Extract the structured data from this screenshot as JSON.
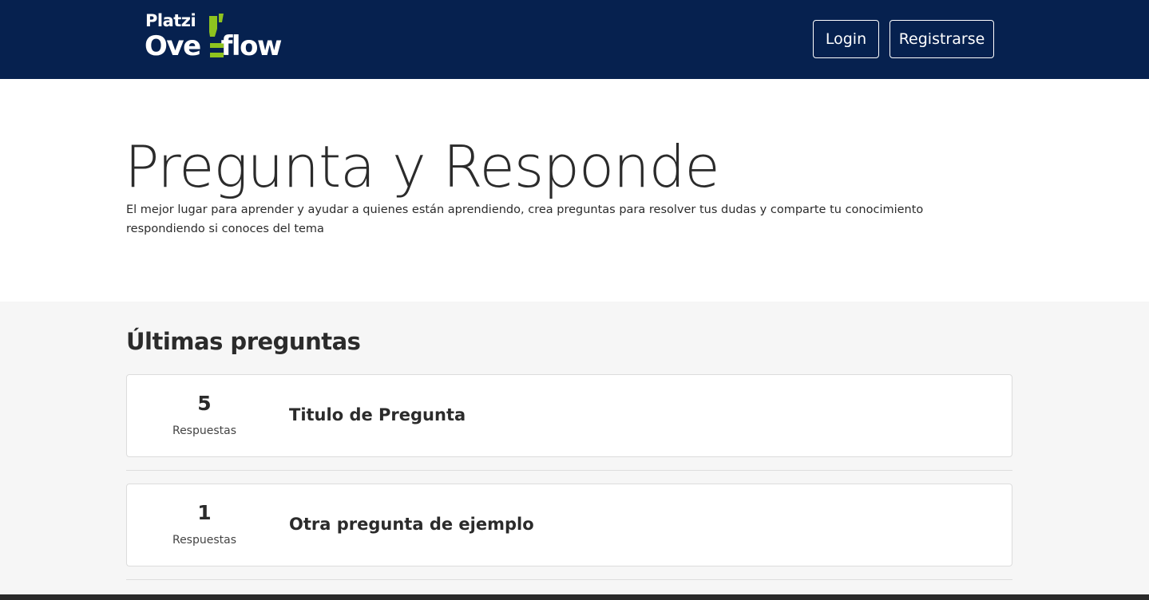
{
  "brand": {
    "top": "Platzi",
    "bottom_left": "Ove",
    "bottom_right": "flow",
    "accent_color": "#8fc31f",
    "nav_color": "#06214f"
  },
  "nav": {
    "login_label": "Login",
    "register_label": "Registrarse"
  },
  "hero": {
    "title": "Pregunta y Responde",
    "text": "El mejor lugar para aprender y ayudar a quienes están aprendiendo, crea preguntas para resolver tus dudas y comparte tu conocimiento respondiendo si conoces del tema"
  },
  "questions": {
    "section_title": "Últimas preguntas",
    "items": [
      {
        "count": "5",
        "count_label": "Respuestas",
        "title": "Titulo de Pregunta"
      },
      {
        "count": "1",
        "count_label": "Respuestas",
        "title": "Otra pregunta de ejemplo"
      }
    ]
  }
}
